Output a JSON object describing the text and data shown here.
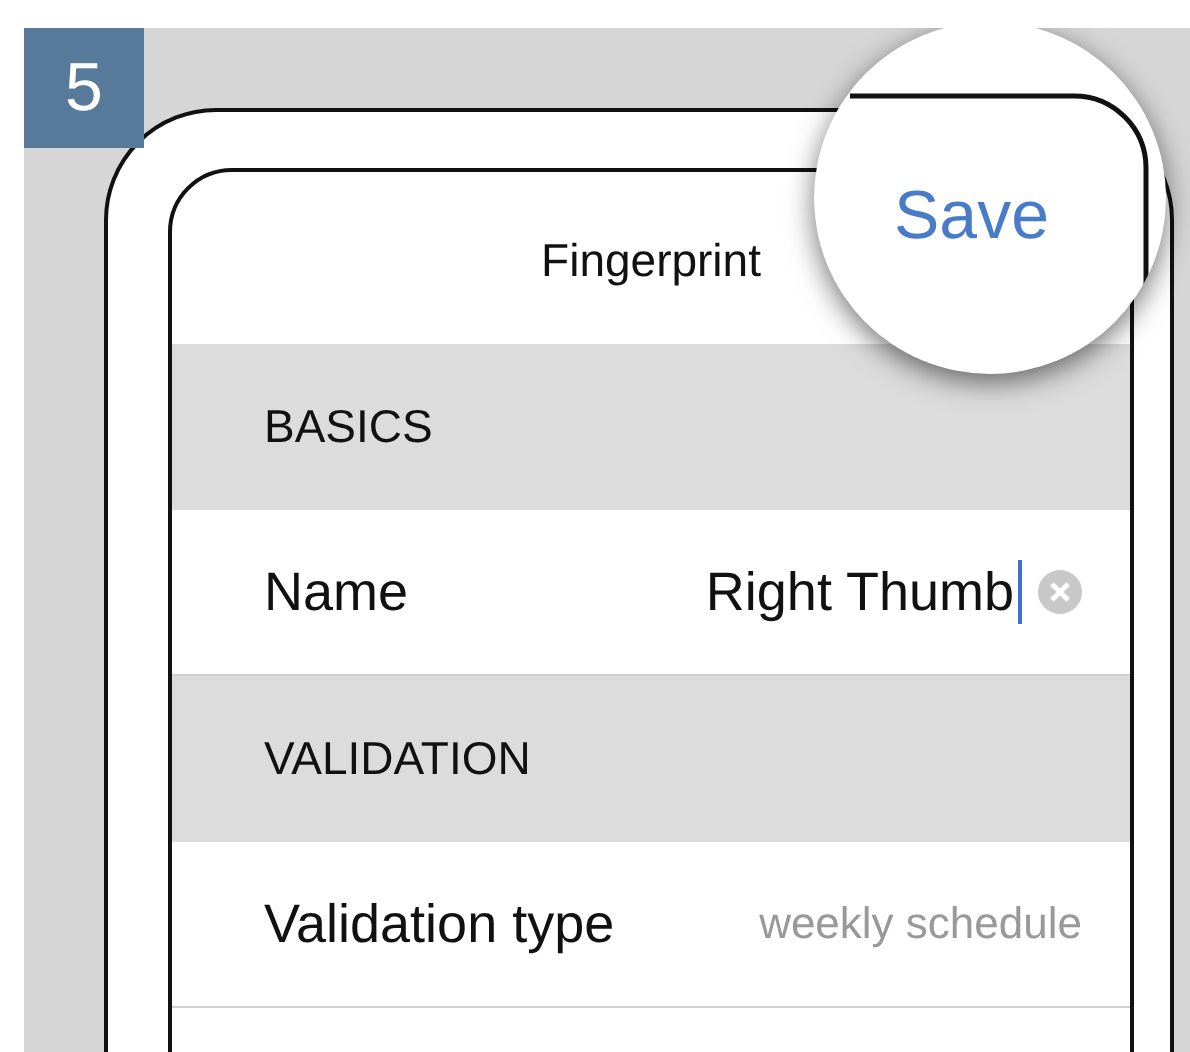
{
  "step_badge": "5",
  "magnifier": {
    "button": "Save"
  },
  "screen": {
    "title": "Fingerprint",
    "sections": [
      {
        "header": "BASICS",
        "rows": [
          {
            "kind": "text_field",
            "label": "Name",
            "value": "Right Thumb",
            "focused": true
          }
        ]
      },
      {
        "header": "VALIDATION",
        "rows": [
          {
            "kind": "detail",
            "label": "Validation type",
            "value": "weekly schedule"
          }
        ]
      }
    ]
  }
}
